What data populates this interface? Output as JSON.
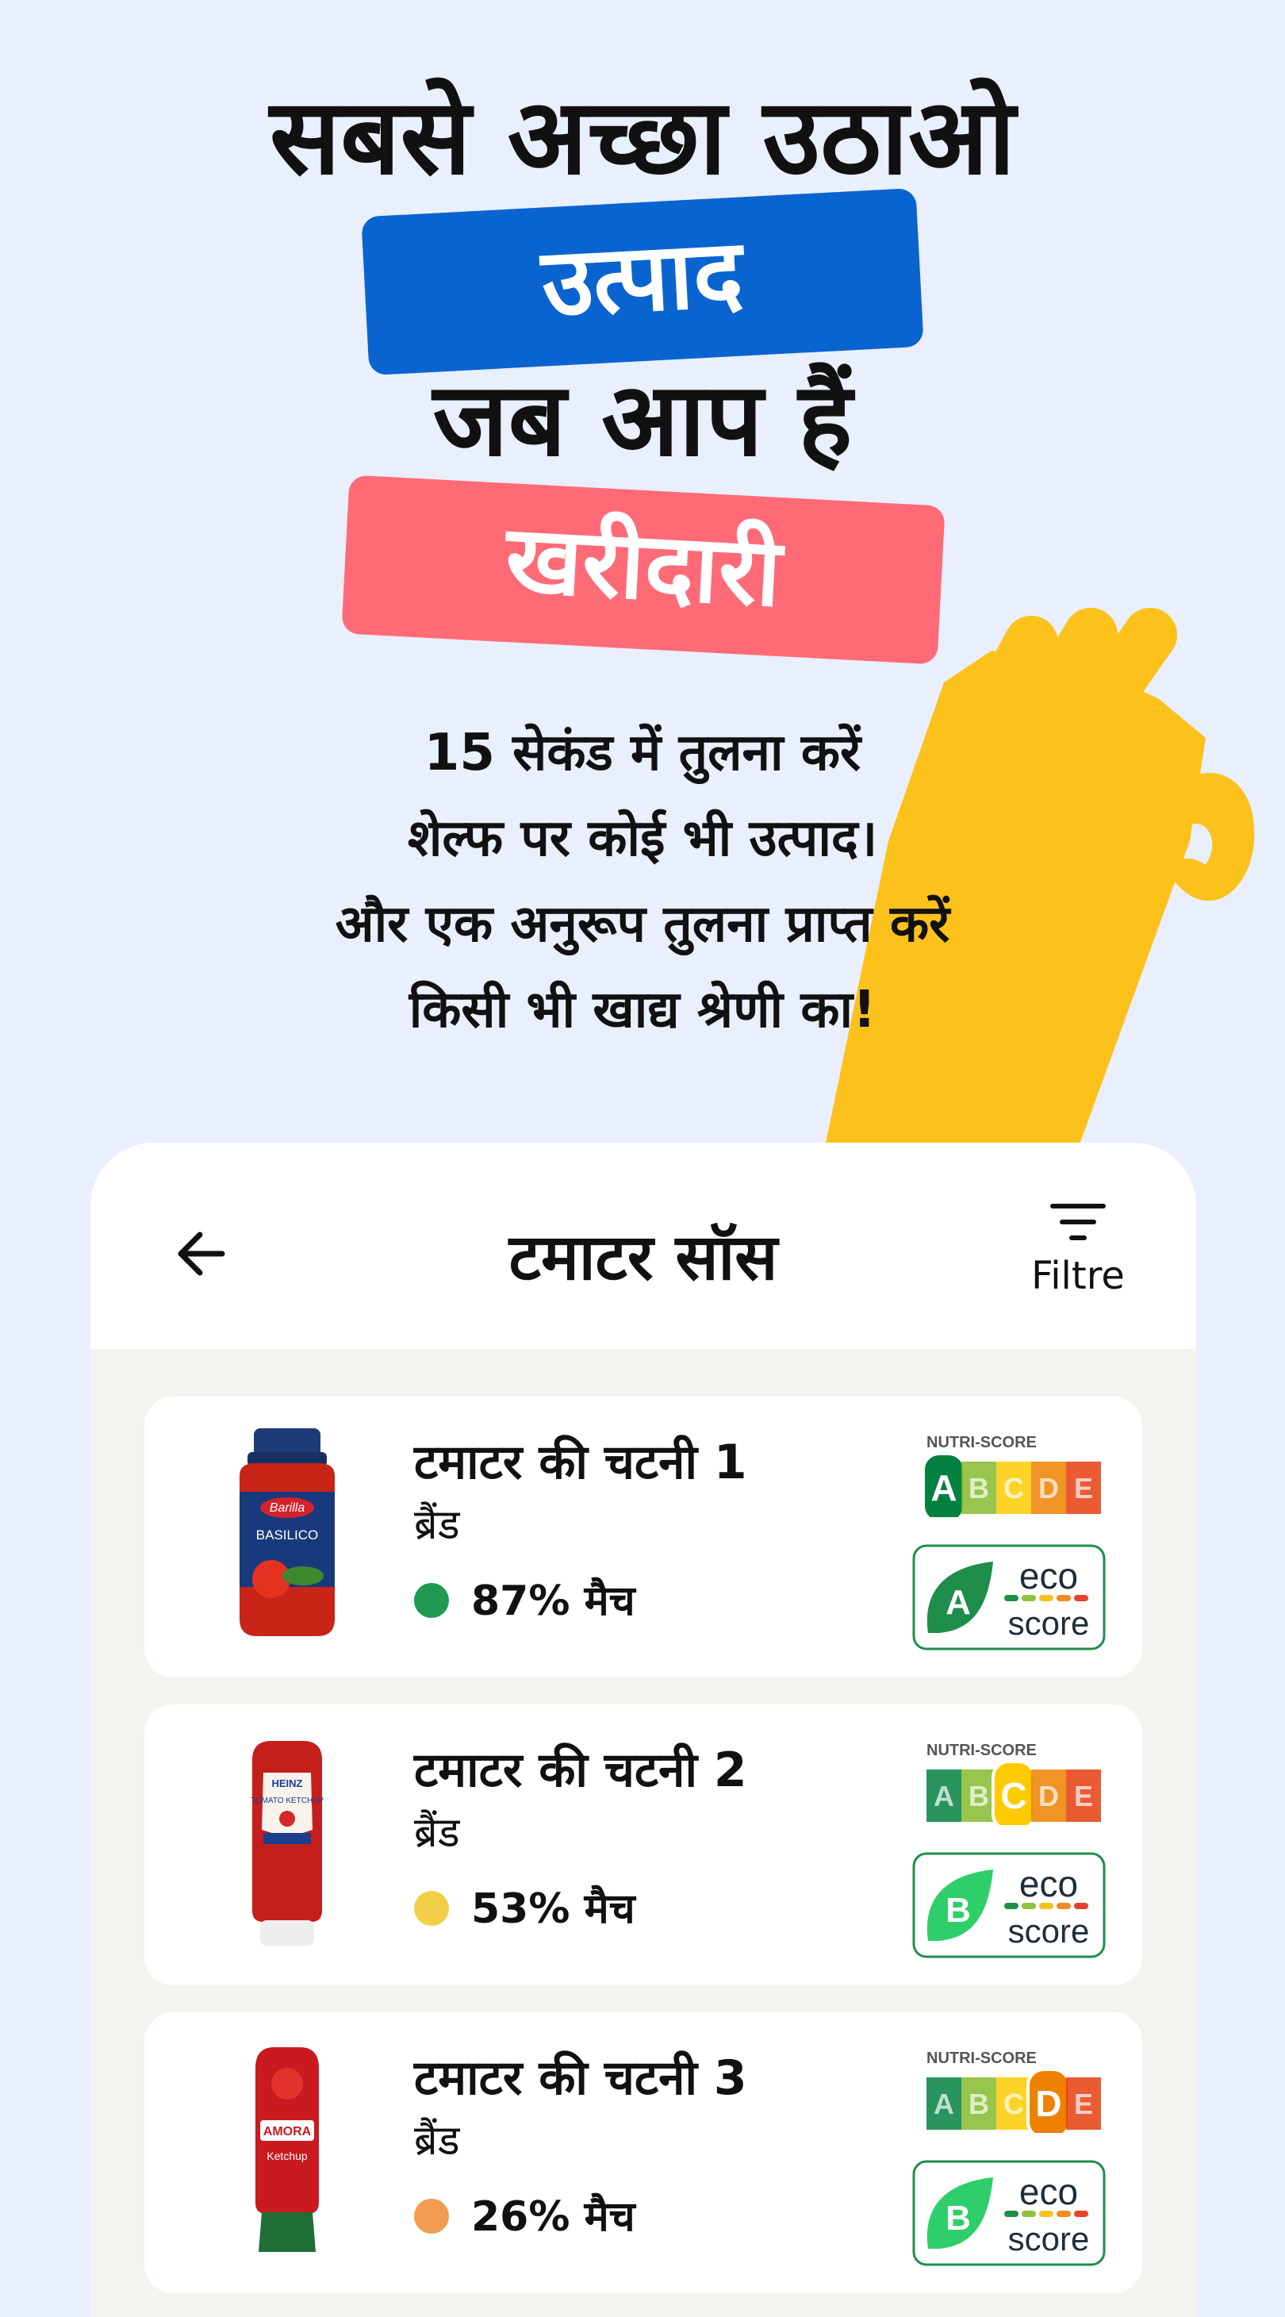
{
  "hero": {
    "line1": "सबसे अच्छा उठाओ",
    "tag1": "उत्पाद",
    "line2": "जब आप हैं",
    "tag2": "खरीदारी",
    "sub": [
      "15 सेकंड में तुलना करें",
      "शेल्फ पर कोई भी उत्पाद।",
      "और एक अनुरूप तुलना प्राप्त करें",
      "किसी भी खाद्य श्रेणी का!"
    ]
  },
  "header": {
    "title": "टमाटर सॉस",
    "filter_label": "Filtre"
  },
  "products": [
    {
      "name": "टमाटर की चटनी 1",
      "brand": "ब्रैंड",
      "match": "87% मैच",
      "match_color": "#1e9a52",
      "nutri_grade": "A",
      "eco_grade": "A",
      "jar_label": "BASILICO",
      "jar_brand": "Barilla"
    },
    {
      "name": "टमाटर की चटनी 2",
      "brand": "ब्रैंड",
      "match": "53% मैच",
      "match_color": "#f1cf4a",
      "nutri_grade": "C",
      "eco_grade": "B",
      "jar_label": "TOMATO KETCHUP",
      "jar_brand": "HEINZ"
    },
    {
      "name": "टमाटर की चटनी 3",
      "brand": "ब्रैंड",
      "match": "26% मैच",
      "match_color": "#f29b4e",
      "nutri_grade": "D",
      "eco_grade": "B",
      "jar_label": "Ketchup",
      "jar_brand": "AMORA"
    }
  ],
  "nutriscore": {
    "label": "NUTRI-SCORE",
    "letters": [
      "A",
      "B",
      "C",
      "D",
      "E"
    ],
    "colors": [
      "#038141",
      "#85bb2f",
      "#fecb02",
      "#ee8100",
      "#e63e11"
    ]
  },
  "ecoscore": {
    "word1": "eco",
    "word2": "score"
  },
  "colors": {
    "background": "#e9effc",
    "blue_tag": "#0a64d0",
    "pink_tag": "#fe6b76",
    "hand": "#fcc21b"
  }
}
